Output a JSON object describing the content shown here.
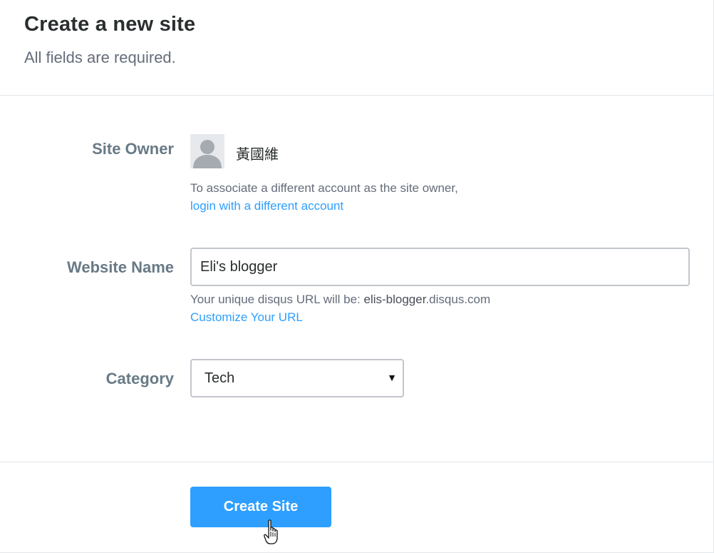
{
  "header": {
    "title": "Create a new site",
    "subtitle": "All fields are required."
  },
  "site_owner": {
    "label": "Site Owner",
    "name": "黃國維",
    "avatar_icon": "user-silhouette-icon",
    "help_text": "To associate a different account as the site owner,",
    "link_label": "login with a different account"
  },
  "website_name": {
    "label": "Website Name",
    "value": "Eli's blogger",
    "help_prefix": "Your unique disqus URL will be: ",
    "url_value": "elis-blogger",
    "url_suffix": ".disqus.com",
    "link_label": "Customize Your URL"
  },
  "category": {
    "label": "Category",
    "selected": "Tech",
    "caret_icon": "caret-down-icon"
  },
  "actions": {
    "create_label": "Create Site"
  },
  "colors": {
    "accent": "#2e9fff",
    "label": "#687a86",
    "border": "#c2c6cc"
  }
}
